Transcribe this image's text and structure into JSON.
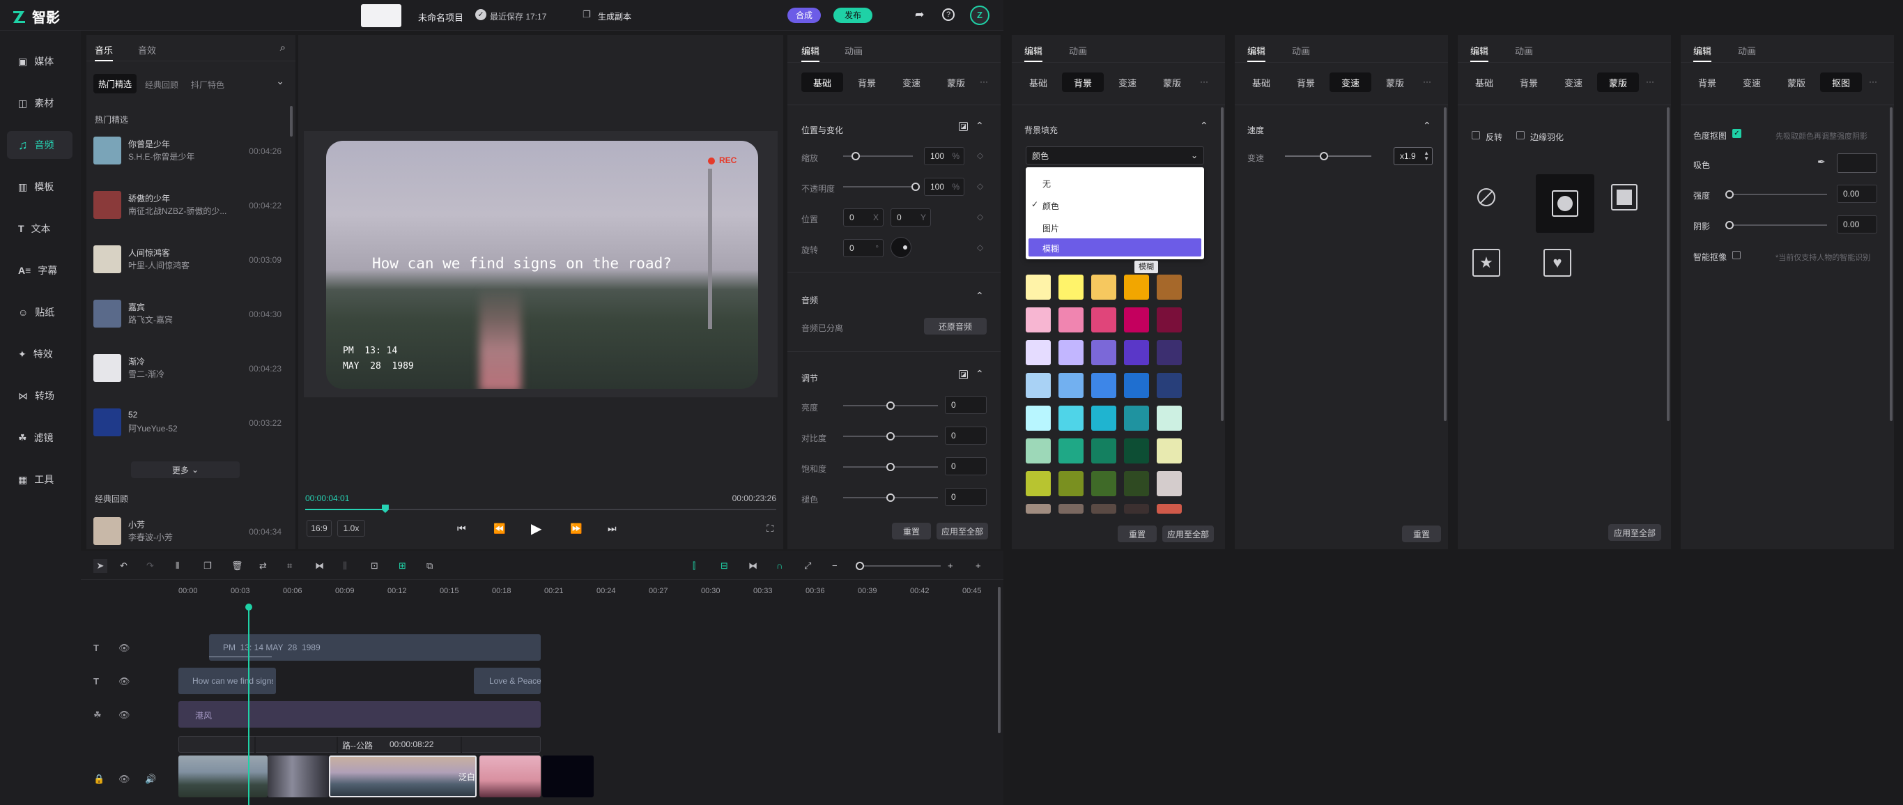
{
  "app": {
    "name": "智影",
    "project_name": "未命名项目",
    "save_status": "最近保存 17:17",
    "generate_copy": "生成副本",
    "compose_btn": "合成",
    "publish_btn": "发布"
  },
  "colors": {
    "accent": "#27d3b4",
    "purple": "#6c5ce7",
    "teal": "#1fd1a6"
  },
  "sidebar": {
    "items": [
      {
        "label": "媒体",
        "icon": "media-icon"
      },
      {
        "label": "素材",
        "icon": "material-icon"
      },
      {
        "label": "音频",
        "icon": "music-note-icon",
        "active": true
      },
      {
        "label": "模板",
        "icon": "template-icon"
      },
      {
        "label": "文本",
        "icon": "text-icon"
      },
      {
        "label": "字幕",
        "icon": "subtitle-icon"
      },
      {
        "label": "贴纸",
        "icon": "sticker-icon"
      },
      {
        "label": "特效",
        "icon": "effect-icon"
      },
      {
        "label": "转场",
        "icon": "transition-icon"
      },
      {
        "label": "滤镜",
        "icon": "filter-icon"
      },
      {
        "label": "工具",
        "icon": "tools-icon"
      }
    ]
  },
  "library": {
    "tabs": [
      "音乐",
      "音效"
    ],
    "filters": [
      "热门精选",
      "经典回顾",
      "抖厂特色"
    ],
    "section1": "热门精选",
    "songs": [
      {
        "title": "你曾是少年",
        "artist": "S.H.E-你曾是少年",
        "duration": "00:04:26",
        "color": "#7aa4b8"
      },
      {
        "title": "骄傲的少年",
        "artist": "南征北战NZBZ-骄傲的少...",
        "duration": "00:04:22",
        "color": "#8a3a3a"
      },
      {
        "title": "人间惊鸿客",
        "artist": "叶里-人间惊鸿客",
        "duration": "00:03:09",
        "color": "#d8d2c4"
      },
      {
        "title": "嘉宾",
        "artist": "路飞文-嘉宾",
        "duration": "00:04:30",
        "color": "#5a6a8a"
      },
      {
        "title": "渐冷",
        "artist": "雪二-渐冷",
        "duration": "00:04:23",
        "color": "#e6e6ea"
      },
      {
        "title": "52",
        "artist": "阿YueYue-52",
        "duration": "00:03:22",
        "color": "#1f3a8a"
      }
    ],
    "more": "更多",
    "section2": "经典回顾",
    "song_extra": {
      "title": "小芳",
      "artist": "李春波-小芳",
      "duration": "00:04:34",
      "color": "#c8b8a8"
    }
  },
  "preview": {
    "caption": "How can we find signs on the road?",
    "time_overlay": "PM  13: 14",
    "date_overlay": "MAY  28  1989",
    "rec": "REC",
    "current_time": "00:00:04:01",
    "total_time": "00:00:23:26",
    "ratio": "16:9",
    "speed": "1.0x",
    "progress": 0.17
  },
  "props": {
    "tabs": [
      "编辑",
      "动画"
    ],
    "subtabs": [
      "基础",
      "背景",
      "变速",
      "蒙版"
    ],
    "section_transform": "位置与变化",
    "scale_label": "缩放",
    "scale_value": "100",
    "unit_percent": "%",
    "opacity_label": "不透明度",
    "opacity_value": "100",
    "position_label": "位置",
    "pos_x": "0",
    "pos_y": "0",
    "x_label": "X",
    "y_label": "Y",
    "rotate_label": "旋转",
    "rotate_value": "0",
    "degree": "°",
    "section_audio": "音频",
    "audio_status": "音频已分离",
    "restore_audio": "还原音频",
    "section_adjust": "调节",
    "brightness_label": "亮度",
    "brightness": "0",
    "contrast_label": "对比度",
    "contrast": "0",
    "saturation_label": "饱和度",
    "saturation": "0",
    "hue_label": "褪色",
    "hue": "0",
    "reset": "重置",
    "apply_all": "应用至全部",
    "more": "···"
  },
  "bg_panel": {
    "title": "背景填充",
    "select_value": "颜色",
    "options": [
      "无",
      "颜色",
      "图片",
      "模糊"
    ],
    "tooltip": "模糊",
    "swatches": [
      [
        "#fff3a8",
        "#fff36a",
        "#f6c85f",
        "#f2a600",
        "#a6682a"
      ],
      [
        "#f7b6d2",
        "#f085b0",
        "#e0457a",
        "#c4005e",
        "#7a0f3a"
      ],
      [
        "#e5dcff",
        "#c2b6ff",
        "#7b68d8",
        "#5a37c8",
        "#3c2f70"
      ],
      [
        "#a9d2f5",
        "#72b0f0",
        "#3d86e8",
        "#1f6fd0",
        "#283f7a"
      ],
      [
        "#b8f6ff",
        "#4fd4e8",
        "#1fb4d0",
        "#1f93a0",
        "#cdf0e2"
      ],
      [
        "#9dd8b8",
        "#1fa886",
        "#148060",
        "#0d4e34",
        "#e8eab0"
      ],
      [
        "#b8c430",
        "#7a9020",
        "#3f6a28",
        "#2f4a22",
        "#d4cccc"
      ],
      [
        "#a08c80",
        "#7a6860",
        "#5a4a44",
        "#3c3030",
        "#d05a4a"
      ]
    ],
    "reset": "重置",
    "apply_all": "应用至全部"
  },
  "speed_panel": {
    "title": "速度",
    "label": "变速",
    "value": "x1.9",
    "reset": "重置"
  },
  "mask_panel": {
    "invert": "反转",
    "feather": "边缘羽化",
    "shapes": [
      "none-icon",
      "circle-mask-icon",
      "rect-mask-icon",
      "star-mask-icon",
      "heart-mask-icon"
    ],
    "apply_all": "应用至全部"
  },
  "cutout_panel": {
    "subtabs": [
      "背景",
      "变速",
      "蒙版",
      "抠图"
    ],
    "chroma_label": "色度抠图",
    "chroma_hint": "先吸取颜色再调整强度阴影",
    "pick_label": "吸色",
    "strength_label": "强度",
    "strength": "0.00",
    "shadow_label": "阴影",
    "shadow": "0.00",
    "smart_label": "智能抠像",
    "smart_hint": "*当前仅支持人物的智能识别"
  },
  "timeline": {
    "ruler": [
      "00:00",
      "00:03",
      "00:06",
      "00:09",
      "00:12",
      "00:15",
      "00:18",
      "00:21",
      "00:24",
      "00:27",
      "00:30",
      "00:33",
      "00:36",
      "00:39",
      "00:42",
      "00:45"
    ],
    "text_clip": "PM  13: 14 MAY  28  1989",
    "subtitle_clip_1": "How can we find signs",
    "subtitle_clip_2": "Love & Peace",
    "filter_clip": "港风",
    "video_clip_label": "路--公路",
    "video_clip_time": "00:00:08:22",
    "transition_label": "泛白"
  }
}
